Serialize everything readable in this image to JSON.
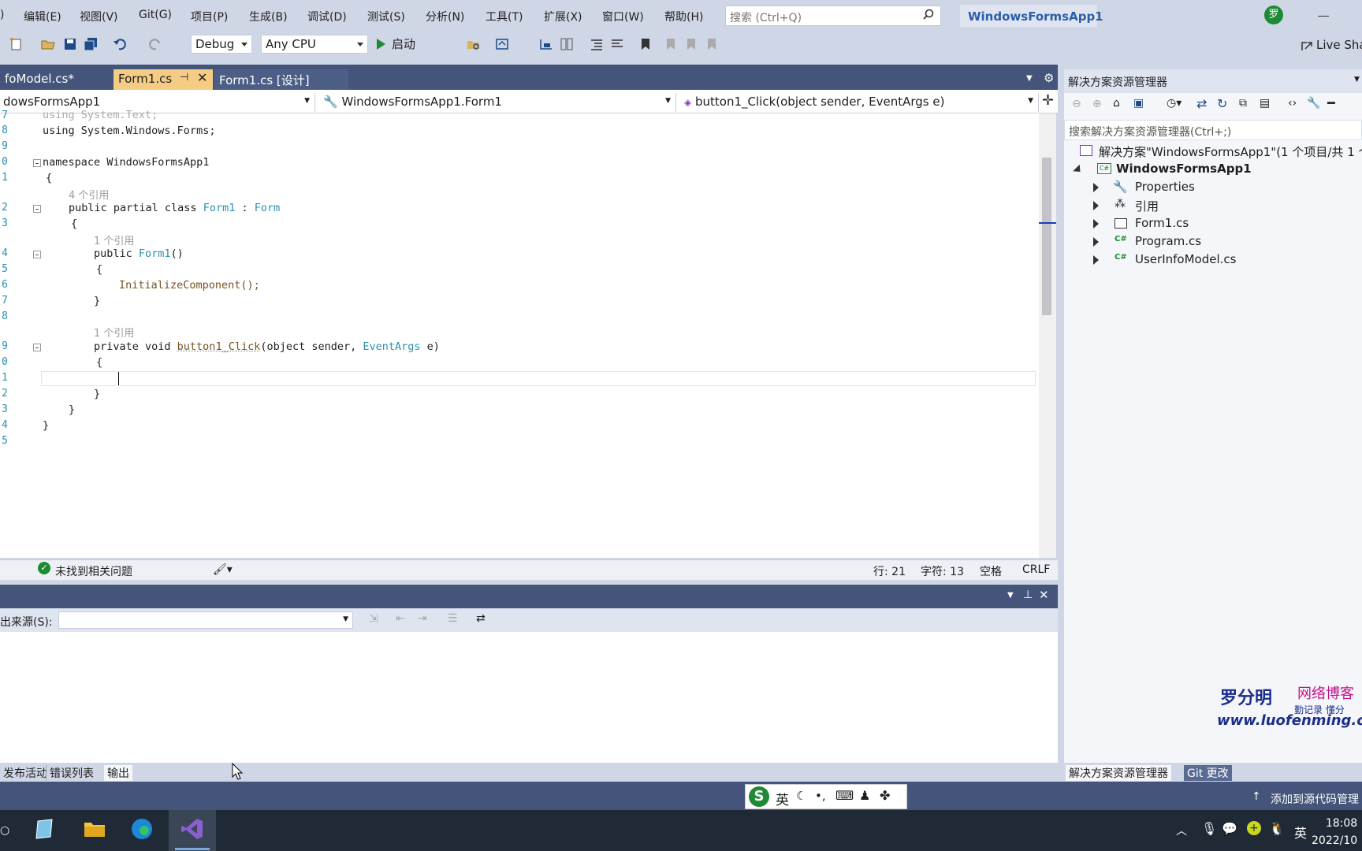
{
  "menubar": {
    "items": [
      ")",
      "编辑(E)",
      "视图(V)",
      "Git(G)",
      "项目(P)",
      "生成(B)",
      "调试(D)",
      "测试(S)",
      "分析(N)",
      "工具(T)",
      "扩展(X)",
      "窗口(W)",
      "帮助(H)"
    ],
    "search_placeholder": "搜索 (Ctrl+Q)",
    "solution_name": "WindowsFormsApp1",
    "avatar_initial": "罗"
  },
  "toolbar": {
    "config": "Debug",
    "platform": "Any CPU",
    "start_label": "启动",
    "live_share": "Live Sha"
  },
  "tabs": [
    {
      "label": "foModel.cs*",
      "active": false
    },
    {
      "label": "Form1.cs",
      "active": true
    },
    {
      "label": "Form1.cs [设计]",
      "active": false
    }
  ],
  "navbar": {
    "project": "dowsFormsApp1",
    "class": "WindowsFormsApp1.Form1",
    "member": "button1_Click(object sender, EventArgs e)"
  },
  "code": {
    "line_numbers": [
      "7",
      "8",
      "9",
      "0",
      "1",
      "",
      "2",
      "3",
      "",
      "4",
      "5",
      "6",
      "7",
      "8",
      "",
      "9",
      "0",
      "1",
      "2",
      "3",
      "4",
      "5"
    ],
    "l7": "using System.Text;",
    "l8": "using System.Windows.Forms;",
    "l10_kw": "namespace",
    "l10_name": " WindowsFormsApp1",
    "l11": "{",
    "ref4": "4 个引用",
    "l12_a": "public partial class ",
    "l12_b": "Form1",
    "l12_c": " : ",
    "l12_d": "Form",
    "l13": "{",
    "ref1a": "1 个引用",
    "l14_a": "public ",
    "l14_b": "Form1",
    "l14_c": "()",
    "l15": "{",
    "l16": "InitializeComponent();",
    "l17": "}",
    "ref1b": "1 个引用",
    "l19_a": "private void ",
    "l19_b": "button1_Click",
    "l19_c": "(object sender, ",
    "l19_d": "EventArgs",
    "l19_e": " e)",
    "l20": "{",
    "l22": "}",
    "l23": "}",
    "l24": "}"
  },
  "editor_status": {
    "issues": "未找到相关问题",
    "line": "行: 21",
    "char": "字符: 13",
    "spaces": "空格",
    "eol": "CRLF"
  },
  "output": {
    "source_label": "出来源(S):"
  },
  "bottom_tabs": [
    "发布活动",
    "错误列表",
    "输出"
  ],
  "solution_explorer": {
    "title": "解决方案资源管理器",
    "search_placeholder": "搜索解决方案资源管理器(Ctrl+;)",
    "solution_line": "解决方案\"WindowsFormsApp1\"(1 个项目/共 1 个",
    "project": "WindowsFormsApp1",
    "items": [
      "Properties",
      "引用",
      "Form1.cs",
      "Program.cs",
      "UserInfoModel.cs"
    ],
    "bottom_tabs": [
      "解决方案资源管理器",
      "Git 更改"
    ]
  },
  "statusstrip": {
    "add_source": "添加到源代码管理"
  },
  "ime": {
    "lang": "英"
  },
  "taskbar": {
    "time": "18:08",
    "date": "2022/10",
    "lang": "英"
  },
  "watermark": {
    "name": "罗分明",
    "blog": "网络博客",
    "slogan": "勤记录 懂分",
    "url": "www.luofenming.com"
  }
}
